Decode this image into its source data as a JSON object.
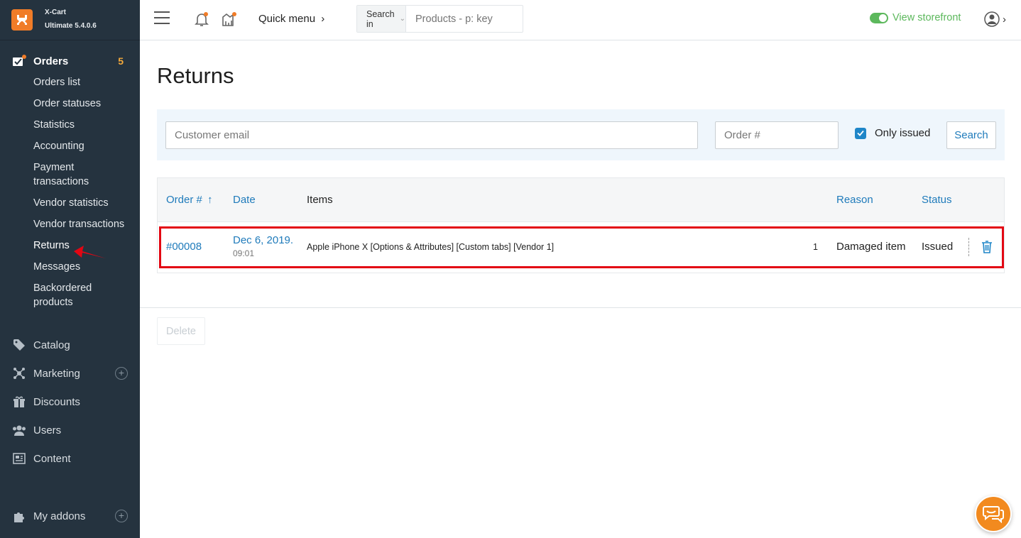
{
  "brand": {
    "name": "X-Cart",
    "version": "Ultimate 5.4.0.6"
  },
  "sidebar": {
    "orders": {
      "label": "Orders",
      "badge": "5"
    },
    "order_items": [
      "Orders list",
      "Order statuses",
      "Statistics",
      "Accounting",
      "Payment transactions",
      "Vendor statistics",
      "Vendor transactions",
      "Returns",
      "Messages",
      "Backordered products"
    ],
    "sections": [
      {
        "label": "Catalog"
      },
      {
        "label": "Marketing"
      },
      {
        "label": "Discounts"
      },
      {
        "label": "Users"
      },
      {
        "label": "Content"
      }
    ],
    "addons": {
      "label": "My addons"
    }
  },
  "header": {
    "quick_menu": "Quick menu",
    "search_in_label": "Search in",
    "search_placeholder": "Products - p: key",
    "storefront": "View storefront"
  },
  "page": {
    "title": "Returns",
    "filter": {
      "email_placeholder": "Customer email",
      "order_placeholder": "Order #",
      "only_issued_label": "Only issued",
      "search_label": "Search"
    },
    "table": {
      "headers": {
        "order": "Order #",
        "date": "Date",
        "items": "Items",
        "reason": "Reason",
        "status": "Status"
      },
      "rows": [
        {
          "order": "#00008",
          "date": "Dec 6, 2019.",
          "time": "09:01",
          "item": "Apple iPhone X [Options & Attributes] [Custom tabs] [Vendor 1]",
          "qty": "1",
          "reason": "Damaged item",
          "status": "Issued"
        }
      ]
    },
    "delete_label": "Delete"
  },
  "colors": {
    "sidebar_bg": "#25333f",
    "accent_orange": "#f07c28",
    "link_blue": "#1f7bbb",
    "green": "#5cb85c",
    "highlight_red": "#e30613"
  }
}
